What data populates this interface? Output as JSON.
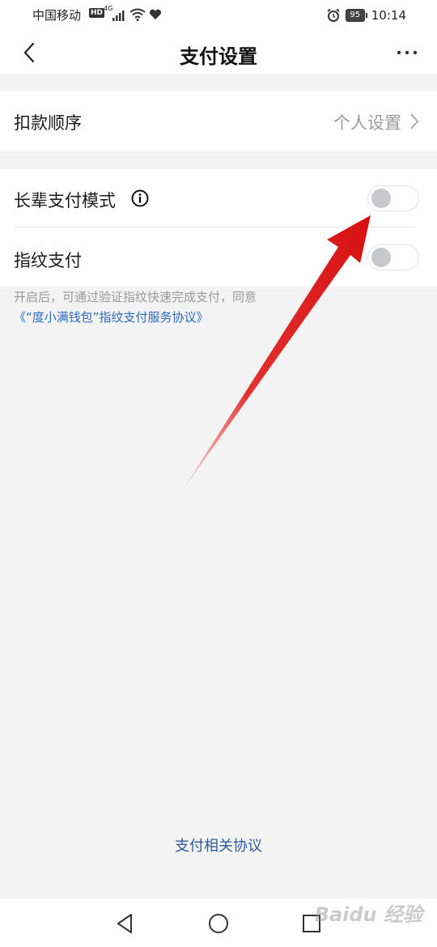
{
  "status_bar": {
    "carrier": "中国移动",
    "hd_badge": "HD",
    "network": "4G",
    "battery": "95",
    "time": "10:14"
  },
  "header": {
    "title": "支付设置"
  },
  "settings": {
    "deduction_order": {
      "label": "扣款顺序",
      "value": "个人设置"
    },
    "elder_mode": {
      "label": "长辈支付模式",
      "enabled": false
    },
    "fingerprint": {
      "label": "指纹支付",
      "enabled": false
    }
  },
  "hint": {
    "text": "开启后，可通过验证指纹快速完成支付，同意",
    "link": "《“度小满钱包”指纹支付服务协议》"
  },
  "footer": {
    "agreements_link": "支付相关协议"
  },
  "watermark": "Baidu 经验",
  "colors": {
    "accent_link": "#2b6bbf",
    "arrow": "#e41b1b"
  }
}
